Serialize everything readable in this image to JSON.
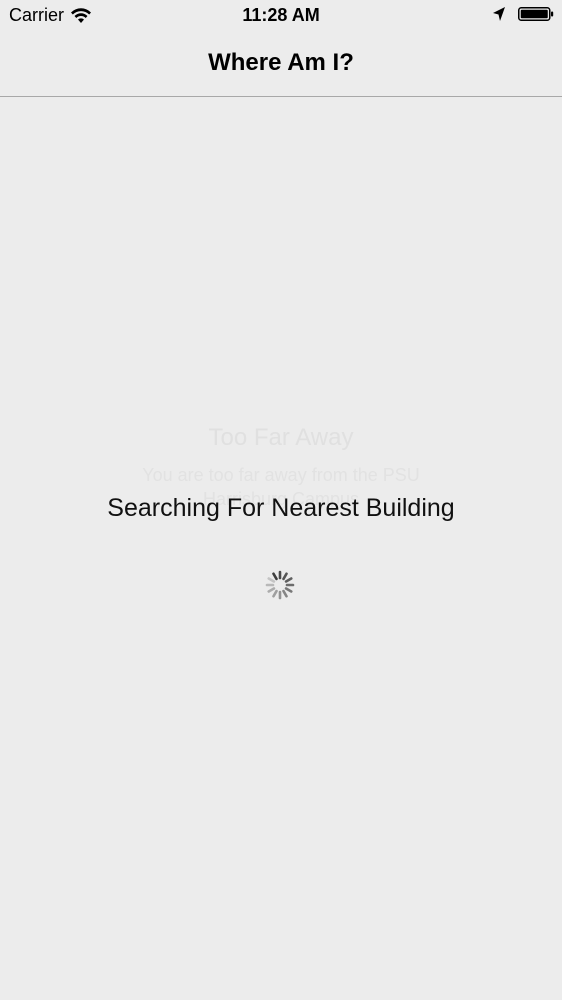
{
  "status_bar": {
    "carrier": "Carrier",
    "time": "11:28 AM",
    "icons": [
      "wifi-icon",
      "location-arrow-icon",
      "battery-icon"
    ]
  },
  "nav": {
    "title": "Where Am I?"
  },
  "faded_alert": {
    "title": "Too Far Away",
    "message": "You are too far away from the PSU Harrisburg Campus"
  },
  "loading": {
    "text": "Searching For Nearest Building",
    "icon": "activity-spinner-icon"
  },
  "colors": {
    "background": "#ececec",
    "divider": "#a8a8a8",
    "text": "#111111",
    "faded_text": "#e0e0e0"
  }
}
